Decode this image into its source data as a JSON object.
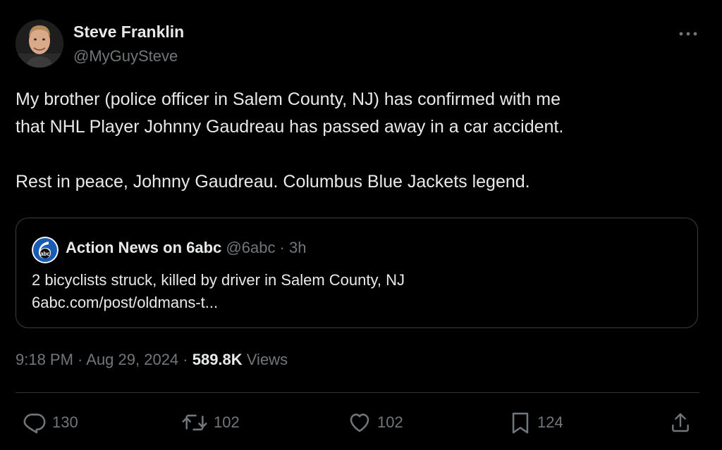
{
  "author": {
    "display_name": "Steve Franklin",
    "handle": "@MyGuySteve"
  },
  "tweet": {
    "lines": [
      "My brother (police officer in Salem County, NJ) has confirmed with me",
      "that NHL Player Johnny Gaudreau has passed away in a car accident.",
      "Rest in peace, Johnny Gaudreau. Columbus Blue Jackets legend."
    ]
  },
  "quote": {
    "name": "Action News on 6abc",
    "meta": "@6abc · 3h",
    "headline": "2 bicyclists struck, killed by driver in Salem County, NJ",
    "link": "6abc.com/post/oldmans-t...",
    "avatar_text": "abc"
  },
  "meta": {
    "time": "9:18 PM · Aug 29, 2024 · ",
    "views_count": "589.8K",
    "views_label": " Views"
  },
  "actions": {
    "replies": "130",
    "reposts": "102",
    "likes": "102",
    "bookmarks": "124"
  },
  "icons": {
    "more": "more-horizontal-icon",
    "reply": "reply-icon",
    "repost": "repost-icon",
    "like": "heart-icon",
    "bookmark": "bookmark-icon",
    "share": "share-icon"
  },
  "colors": {
    "background": "#000000",
    "text": "#e7e9ea",
    "secondary": "#71767b",
    "border": "#3a3d41",
    "abc_blue": "#1a5bb5"
  }
}
